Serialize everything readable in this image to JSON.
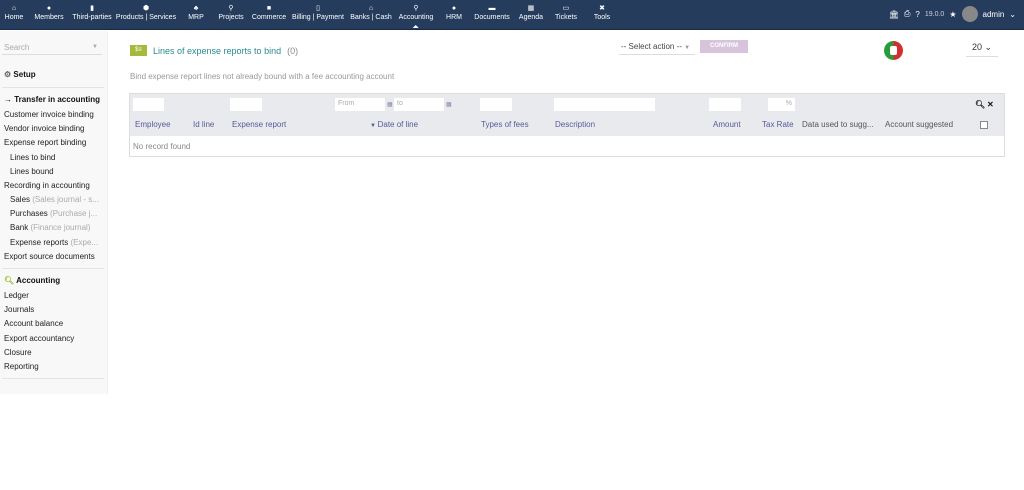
{
  "topnav": {
    "items": [
      {
        "label": "Home",
        "icon": "home-icon"
      },
      {
        "label": "Members",
        "icon": "user-icon"
      },
      {
        "label": "Third-parties",
        "icon": "building-icon"
      },
      {
        "label": "Products | Services",
        "icon": "cube-icon"
      },
      {
        "label": "MRP",
        "icon": "cubes-icon"
      },
      {
        "label": "Projects",
        "icon": "sitemap-icon"
      },
      {
        "label": "Commerce",
        "icon": "briefcase-icon"
      },
      {
        "label": "Billing | Payment",
        "icon": "file-invoice-icon"
      },
      {
        "label": "Banks | Cash",
        "icon": "bank-icon"
      },
      {
        "label": "Accounting",
        "icon": "search-dollar-icon",
        "active": true
      },
      {
        "label": "HRM",
        "icon": "user-tie-icon"
      },
      {
        "label": "Documents",
        "icon": "folder-icon"
      },
      {
        "label": "Agenda",
        "icon": "calendar-icon"
      },
      {
        "label": "Tickets",
        "icon": "ticket-icon"
      },
      {
        "label": "Tools",
        "icon": "tools-icon"
      }
    ],
    "version": "19.0.0",
    "user": "admin"
  },
  "sidebar": {
    "search_placeholder": "Search",
    "setup": "Setup",
    "transfer": "Transfer in accounting",
    "items": [
      "Customer invoice binding",
      "Vendor invoice binding",
      "Expense report binding",
      "Lines to bind",
      "Lines bound",
      "Recording in accounting"
    ],
    "journals": [
      {
        "label": "Sales",
        "hint": "(Sales journal - s..."
      },
      {
        "label": "Purchases",
        "hint": "(Purchase j..."
      },
      {
        "label": "Bank",
        "hint": "(Finance journal)"
      },
      {
        "label": "Expense reports",
        "hint": "(Expe..."
      }
    ],
    "export_source": "Export source documents",
    "accounting": "Accounting",
    "acc_items": [
      "Ledger",
      "Journals",
      "Account balance",
      "Export accountancy",
      "Closure",
      "Reporting"
    ]
  },
  "main": {
    "title": "Lines of expense reports to bind",
    "count": "(0)",
    "description": "Bind expense report lines not already bound with a fee accounting account",
    "select_action": "-- Select action --",
    "confirm": "CONFIRM",
    "page_size": "20",
    "filters": {
      "from": "From",
      "to": "to",
      "percent": "%"
    },
    "columns": [
      "Employee",
      "Id line",
      "Expense report",
      "Date of line",
      "Types of fees",
      "Description",
      "Amount",
      "Tax Rate",
      "Data used to sugg...",
      "Account suggested"
    ],
    "empty": "No record found"
  }
}
